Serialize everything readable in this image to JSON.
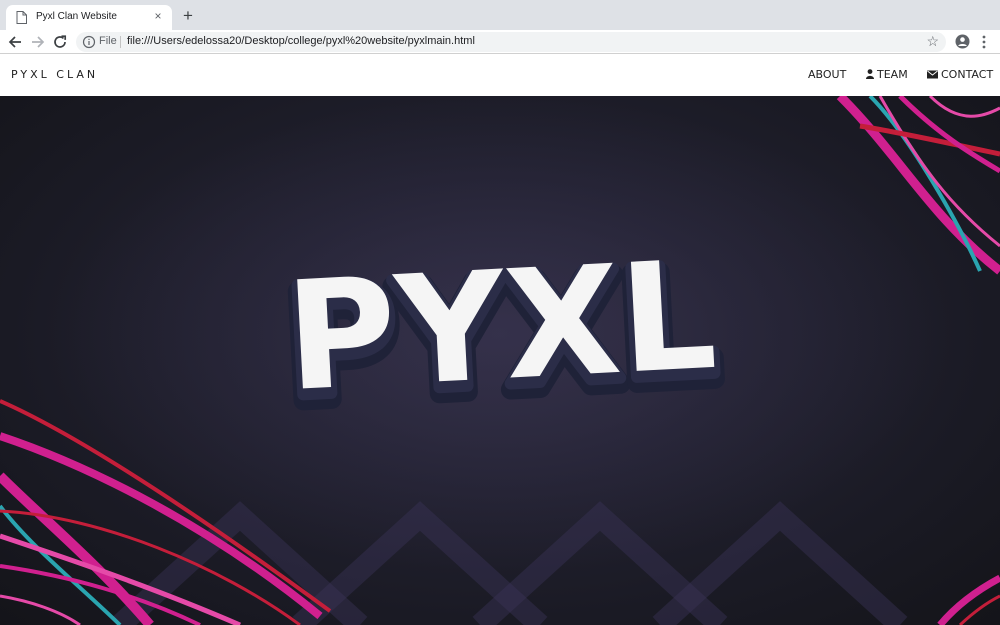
{
  "browser": {
    "tab_title": "Pyxl Clan Website",
    "new_tab_label": "+",
    "close_label": "×",
    "scheme_label": "File",
    "url": "file:///Users/edelossa20/Desktop/college/pyxl%20website/pyxlmain.html"
  },
  "site": {
    "brand": "PYXL CLAN",
    "nav": [
      {
        "label": "ABOUT",
        "icon": null
      },
      {
        "label": "TEAM",
        "icon": "user-icon"
      },
      {
        "label": "CONTACT",
        "icon": "envelope-icon"
      }
    ]
  },
  "hero": {
    "logo_text": "PYXL",
    "colors": {
      "background": "#1c1b26",
      "accent_pink": "#d0208f",
      "accent_red": "#c41e3a",
      "accent_teal": "#2aa5b0",
      "logo_fill": "#f5f5f5",
      "logo_outline": "#2b2d48"
    }
  }
}
